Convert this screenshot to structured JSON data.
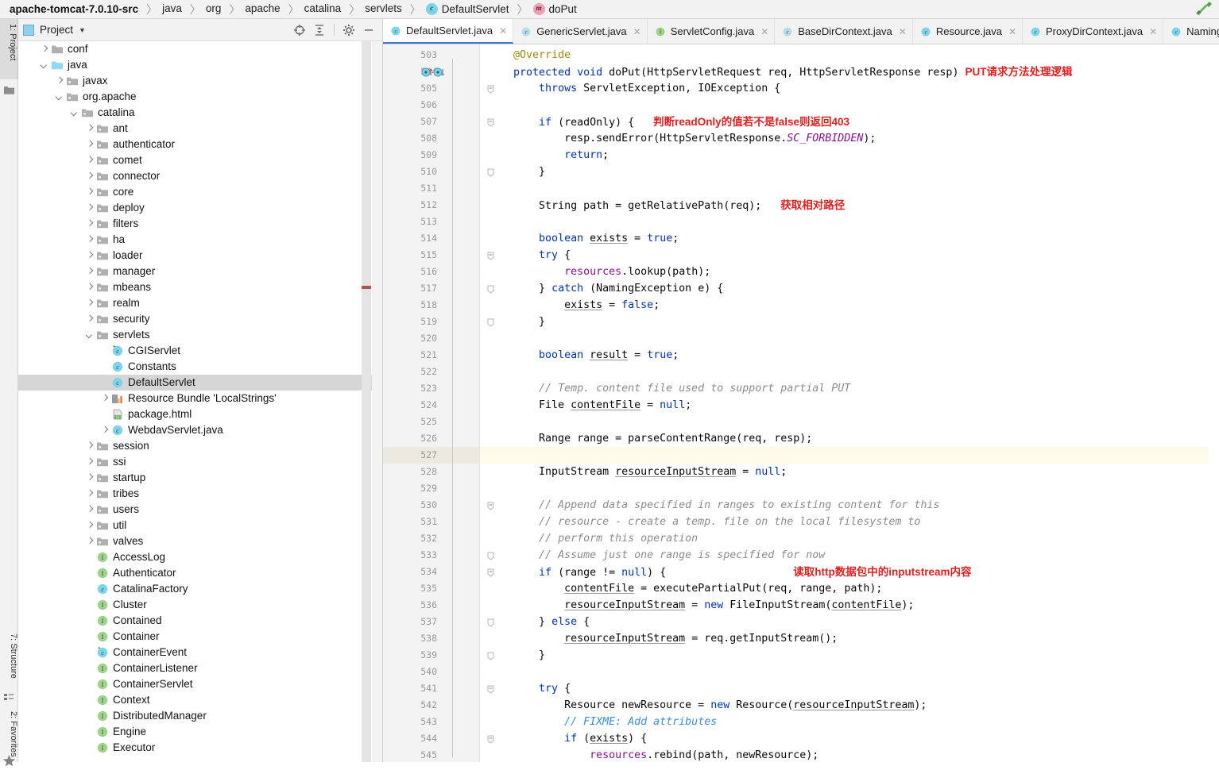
{
  "navbar": {
    "crumbs": [
      {
        "label": "apache-tomcat-7.0.10-src",
        "icon": "none",
        "root": true,
        "wavy": false
      },
      {
        "label": "java",
        "icon": "none",
        "root": false,
        "wavy": true
      },
      {
        "label": "org",
        "icon": "none",
        "root": false,
        "wavy": true
      },
      {
        "label": "apache",
        "icon": "none",
        "root": false,
        "wavy": true
      },
      {
        "label": "catalina",
        "icon": "none",
        "root": false,
        "wavy": true
      },
      {
        "label": "servlets",
        "icon": "none",
        "root": false,
        "wavy": true
      },
      {
        "label": "DefaultServlet",
        "icon": "class-icon",
        "root": false,
        "wavy": false
      },
      {
        "label": "doPut",
        "icon": "method-icon",
        "root": false,
        "wavy": false
      }
    ],
    "build_icon": "hammer-build-icon"
  },
  "toolstrip": {
    "tabs": [
      {
        "label": "1: Project",
        "selected": true,
        "icon": "project-folder-icon"
      },
      {
        "label": "7: Structure",
        "selected": false,
        "icon": "structure-icon"
      },
      {
        "label": "2: Favorites",
        "selected": false,
        "icon": "star-icon"
      }
    ]
  },
  "project_panel": {
    "title": "Project",
    "caret": "▼",
    "tools": [
      {
        "name": "scroll-from-source-icon",
        "label": "target"
      },
      {
        "name": "collapse-all-icon",
        "label": "collapse"
      },
      {
        "name": "gear-icon",
        "label": "settings"
      },
      {
        "name": "hide-icon",
        "label": "minimize"
      }
    ],
    "tree": [
      {
        "label": "conf",
        "depth": 1,
        "arrow": "r",
        "icon": "folder",
        "sel": false,
        "wavy": false
      },
      {
        "label": "java",
        "depth": 1,
        "arrow": "d",
        "icon": "folder-src",
        "sel": false,
        "wavy": true
      },
      {
        "label": "javax",
        "depth": 2,
        "arrow": "r",
        "icon": "package",
        "sel": false,
        "wavy": false
      },
      {
        "label": "org.apache",
        "depth": 2,
        "arrow": "d",
        "icon": "package",
        "sel": false,
        "wavy": true
      },
      {
        "label": "catalina",
        "depth": 3,
        "arrow": "d",
        "icon": "package",
        "sel": false,
        "wavy": true
      },
      {
        "label": "ant",
        "depth": 4,
        "arrow": "r",
        "icon": "package",
        "sel": false,
        "wavy": false
      },
      {
        "label": "authenticator",
        "depth": 4,
        "arrow": "r",
        "icon": "package",
        "sel": false,
        "wavy": false
      },
      {
        "label": "comet",
        "depth": 4,
        "arrow": "r",
        "icon": "package",
        "sel": false,
        "wavy": false
      },
      {
        "label": "connector",
        "depth": 4,
        "arrow": "r",
        "icon": "package",
        "sel": false,
        "wavy": false
      },
      {
        "label": "core",
        "depth": 4,
        "arrow": "r",
        "icon": "package",
        "sel": false,
        "wavy": false
      },
      {
        "label": "deploy",
        "depth": 4,
        "arrow": "r",
        "icon": "package",
        "sel": false,
        "wavy": false
      },
      {
        "label": "filters",
        "depth": 4,
        "arrow": "r",
        "icon": "package",
        "sel": false,
        "wavy": false
      },
      {
        "label": "ha",
        "depth": 4,
        "arrow": "r",
        "icon": "package",
        "sel": false,
        "wavy": false
      },
      {
        "label": "loader",
        "depth": 4,
        "arrow": "r",
        "icon": "package",
        "sel": false,
        "wavy": false
      },
      {
        "label": "manager",
        "depth": 4,
        "arrow": "r",
        "icon": "package",
        "sel": false,
        "wavy": false
      },
      {
        "label": "mbeans",
        "depth": 4,
        "arrow": "r",
        "icon": "package",
        "sel": false,
        "wavy": false
      },
      {
        "label": "realm",
        "depth": 4,
        "arrow": "r",
        "icon": "package",
        "sel": false,
        "wavy": false
      },
      {
        "label": "security",
        "depth": 4,
        "arrow": "r",
        "icon": "package",
        "sel": false,
        "wavy": false
      },
      {
        "label": "servlets",
        "depth": 4,
        "arrow": "d",
        "icon": "package",
        "sel": false,
        "wavy": false
      },
      {
        "label": "CGIServlet",
        "depth": 5,
        "arrow": "none",
        "icon": "class-ovr",
        "sel": false,
        "wavy": false
      },
      {
        "label": "Constants",
        "depth": 5,
        "arrow": "none",
        "icon": "class",
        "sel": false,
        "wavy": false
      },
      {
        "label": "DefaultServlet",
        "depth": 5,
        "arrow": "none",
        "icon": "class",
        "sel": true,
        "wavy": false
      },
      {
        "label": "Resource Bundle 'LocalStrings'",
        "depth": 5,
        "arrow": "r",
        "icon": "bundle",
        "sel": false,
        "wavy": false
      },
      {
        "label": "package.html",
        "depth": 5,
        "arrow": "none",
        "icon": "html",
        "sel": false,
        "wavy": false
      },
      {
        "label": "WebdavServlet.java",
        "depth": 5,
        "arrow": "r",
        "icon": "class",
        "sel": false,
        "wavy": false
      },
      {
        "label": "session",
        "depth": 4,
        "arrow": "r",
        "icon": "package",
        "sel": false,
        "wavy": false
      },
      {
        "label": "ssi",
        "depth": 4,
        "arrow": "r",
        "icon": "package",
        "sel": false,
        "wavy": false
      },
      {
        "label": "startup",
        "depth": 4,
        "arrow": "r",
        "icon": "package",
        "sel": false,
        "wavy": false
      },
      {
        "label": "tribes",
        "depth": 4,
        "arrow": "r",
        "icon": "package",
        "sel": false,
        "wavy": true
      },
      {
        "label": "users",
        "depth": 4,
        "arrow": "r",
        "icon": "package",
        "sel": false,
        "wavy": false
      },
      {
        "label": "util",
        "depth": 4,
        "arrow": "r",
        "icon": "package",
        "sel": false,
        "wavy": false
      },
      {
        "label": "valves",
        "depth": 4,
        "arrow": "r",
        "icon": "package",
        "sel": false,
        "wavy": false
      },
      {
        "label": "AccessLog",
        "depth": 4,
        "arrow": "none",
        "icon": "interface",
        "sel": false,
        "wavy": false
      },
      {
        "label": "Authenticator",
        "depth": 4,
        "arrow": "none",
        "icon": "interface",
        "sel": false,
        "wavy": false
      },
      {
        "label": "CatalinaFactory",
        "depth": 4,
        "arrow": "none",
        "icon": "class",
        "sel": false,
        "wavy": false
      },
      {
        "label": "Cluster",
        "depth": 4,
        "arrow": "none",
        "icon": "interface",
        "sel": false,
        "wavy": false
      },
      {
        "label": "Contained",
        "depth": 4,
        "arrow": "none",
        "icon": "interface",
        "sel": false,
        "wavy": false
      },
      {
        "label": "Container",
        "depth": 4,
        "arrow": "none",
        "icon": "interface",
        "sel": false,
        "wavy": false
      },
      {
        "label": "ContainerEvent",
        "depth": 4,
        "arrow": "none",
        "icon": "class-ovr",
        "sel": false,
        "wavy": false
      },
      {
        "label": "ContainerListener",
        "depth": 4,
        "arrow": "none",
        "icon": "interface",
        "sel": false,
        "wavy": false
      },
      {
        "label": "ContainerServlet",
        "depth": 4,
        "arrow": "none",
        "icon": "interface",
        "sel": false,
        "wavy": false
      },
      {
        "label": "Context",
        "depth": 4,
        "arrow": "none",
        "icon": "interface",
        "sel": false,
        "wavy": false
      },
      {
        "label": "DistributedManager",
        "depth": 4,
        "arrow": "none",
        "icon": "interface",
        "sel": false,
        "wavy": false
      },
      {
        "label": "Engine",
        "depth": 4,
        "arrow": "none",
        "icon": "interface",
        "sel": false,
        "wavy": false
      },
      {
        "label": "Executor",
        "depth": 4,
        "arrow": "none",
        "icon": "interface",
        "sel": false,
        "wavy": false
      }
    ]
  },
  "editor_tabs": [
    {
      "label": "DefaultServlet.java",
      "icon": "class",
      "active": true
    },
    {
      "label": "GenericServlet.java",
      "icon": "class-abs",
      "active": false
    },
    {
      "label": "ServletConfig.java",
      "icon": "interface",
      "active": false
    },
    {
      "label": "BaseDirContext.java",
      "icon": "class-abs",
      "active": false
    },
    {
      "label": "Resource.java",
      "icon": "class",
      "active": false
    },
    {
      "label": "ProxyDirContext.java",
      "icon": "class",
      "active": false
    },
    {
      "label": "NamingContext",
      "icon": "class",
      "active": false
    }
  ],
  "editor": {
    "first_line": 503,
    "current_line": 527,
    "lines": [
      {
        "n": 503,
        "html": "    <span class='ann'>@Override</span>"
      },
      {
        "n": 504,
        "html": "    <span class='kw'>protected</span> <span class='kw'>void</span> doPut(HttpServletRequest req, HttpServletResponse resp) <span class='note'>PUT请求方法处理逻辑</span>",
        "overrideicons": true
      },
      {
        "n": 505,
        "html": "        <span class='kw'>throws</span> ServletException, IOException {",
        "fold": "minus"
      },
      {
        "n": 506,
        "html": ""
      },
      {
        "n": 507,
        "html": "        <span class='kw'>if</span> (<span class='err-squig'>readOnly</span>) {   <span class='note'>判断readOnly的值若不是false则返回403</span>",
        "fold": "minus"
      },
      {
        "n": 508,
        "html": "            resp.sendError(HttpServletResponse.<span class='sf'>SC_FORBIDDEN</span>);"
      },
      {
        "n": 509,
        "html": "            <span class='kw'>return</span>;"
      },
      {
        "n": 510,
        "html": "        }",
        "fold": "end"
      },
      {
        "n": 511,
        "html": ""
      },
      {
        "n": 512,
        "html": "        String path = getRelativePath(req);   <span class='note'>获取相对路径</span>"
      },
      {
        "n": 513,
        "html": ""
      },
      {
        "n": 514,
        "html": "        <span class='kw'>boolean</span> <span class='un'>exists</span> = <span class='kw'>true</span>;"
      },
      {
        "n": 515,
        "html": "        <span class='kw'>try</span> {",
        "fold": "minus"
      },
      {
        "n": 516,
        "html": "            <span class='fld'>resources</span>.lookup(path);"
      },
      {
        "n": 517,
        "html": "        } <span class='kw'>catch</span> (NamingException e) {",
        "fold": "end"
      },
      {
        "n": 518,
        "html": "            <span class='un'>exists</span> = <span class='kw'>false</span>;"
      },
      {
        "n": 519,
        "html": "        }",
        "fold": "end"
      },
      {
        "n": 520,
        "html": ""
      },
      {
        "n": 521,
        "html": "        <span class='kw'>boolean</span> <span class='un'>result</span> = <span class='kw'>true</span>;"
      },
      {
        "n": 522,
        "html": ""
      },
      {
        "n": 523,
        "html": "        <span class='cm'>// Temp. content file used to support partial PUT</span>"
      },
      {
        "n": 524,
        "html": "        File <span class='un'>contentFile</span> = <span class='kw'>null</span>;"
      },
      {
        "n": 525,
        "html": ""
      },
      {
        "n": 526,
        "html": "        Range range = parseContentRange(req, resp);"
      },
      {
        "n": 527,
        "html": ""
      },
      {
        "n": 528,
        "html": "        InputStream <span class='un'>resourceInputStream</span> = <span class='kw'>null</span>;"
      },
      {
        "n": 529,
        "html": ""
      },
      {
        "n": 530,
        "html": "        <span class='cm'>// Append data specified in ranges to existing content for this</span>",
        "fold": "minus"
      },
      {
        "n": 531,
        "html": "        <span class='cm'>// resource - create a temp. file on the local filesystem to</span>"
      },
      {
        "n": 532,
        "html": "        <span class='cm'>// perform this operation</span>"
      },
      {
        "n": 533,
        "html": "        <span class='cm'>// Assume just one range is specified for now</span>",
        "fold": "end"
      },
      {
        "n": 534,
        "html": "        <span class='kw'>if</span> (range != <span class='kw'>null</span>) {                    <span class='note'>读取http数据包中的inputstream内容</span>",
        "fold": "minus"
      },
      {
        "n": 535,
        "html": "            <span class='un'>contentFile</span> = executePartialPut(req, range, path);"
      },
      {
        "n": 536,
        "html": "            <span class='un'>resourceInputStream</span> = <span class='kw'>new</span> FileInputStream(<span class='un'>contentFile</span>);"
      },
      {
        "n": 537,
        "html": "        } <span class='kw'>else</span> {",
        "fold": "end"
      },
      {
        "n": 538,
        "html": "            <span class='un'>resourceInputStream</span> = req.getInputStream();"
      },
      {
        "n": 539,
        "html": "        }",
        "fold": "end"
      },
      {
        "n": 540,
        "html": ""
      },
      {
        "n": 541,
        "html": "        <span class='kw'>try</span> {",
        "fold": "minus"
      },
      {
        "n": 542,
        "html": "            Resource newResource = <span class='kw'>new</span> Resource(<span class='un'>resourceInputStream</span>);"
      },
      {
        "n": 543,
        "html": "            <span class='cmb'>// FIXME: Add attributes</span>"
      },
      {
        "n": 544,
        "html": "            <span class='kw'>if</span> (<span class='un'>exists</span>) {",
        "fold": "minus"
      },
      {
        "n": 545,
        "html": "                <span class='fld'>resources</span>.rebind(path, newResource);"
      }
    ]
  },
  "colors": {
    "accent": "#3a7cd0",
    "note_red": "#e02020",
    "keyword_blue": "#0033b3",
    "comment_gray": "#8c8c8c",
    "current_line": "#fcfae8",
    "selection_gray": "#d6d6d6"
  }
}
